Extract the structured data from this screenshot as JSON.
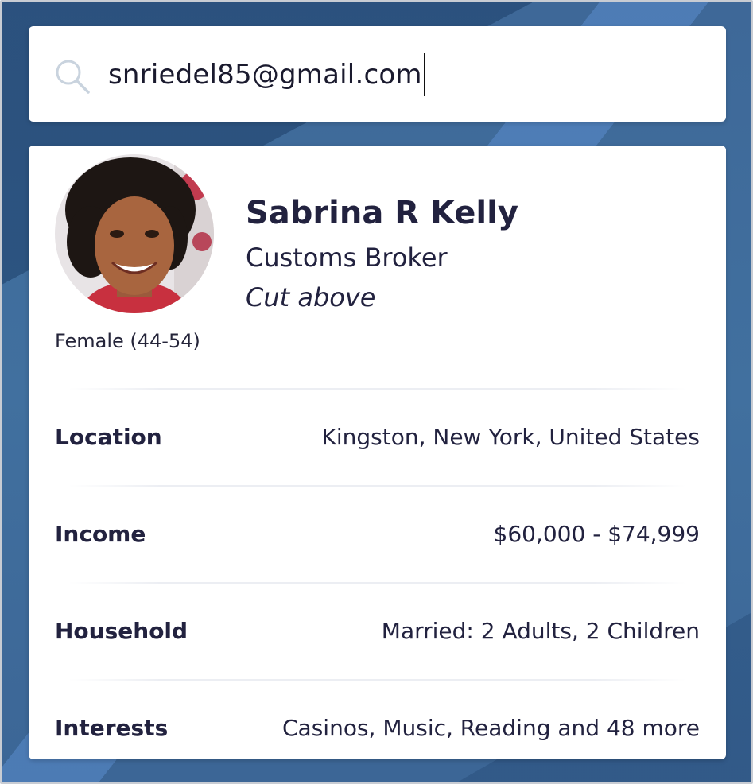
{
  "search": {
    "query": "snriedel85@gmail.com",
    "icon": "search-icon"
  },
  "profile": {
    "name": "Sabrina R Kelly",
    "title": "Customs Broker",
    "tagline": "Cut above",
    "gender_age": "Female (44-54)"
  },
  "details": [
    {
      "label": "Location",
      "value": "Kingston, New York, United States"
    },
    {
      "label": "Income",
      "value": "$60,000 - $74,999"
    },
    {
      "label": "Household",
      "value": "Married: 2 Adults, 2 Children"
    },
    {
      "label": "Interests",
      "value": "Casinos, Music, Reading and 48 more"
    }
  ],
  "colors": {
    "background": "#41709f",
    "card": "#ffffff",
    "text": "#22223f",
    "icon": "#c9d3de"
  }
}
